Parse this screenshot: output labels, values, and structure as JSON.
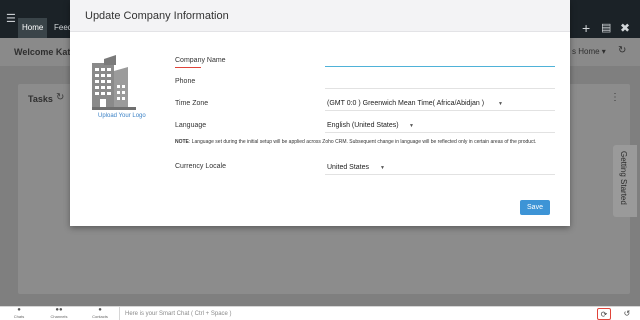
{
  "topbar": {
    "tabs": [
      {
        "label": "Home"
      },
      {
        "label": "Feeds"
      }
    ]
  },
  "subbar": {
    "welcome": "Welcome Kath",
    "home_tab": "s Home"
  },
  "tasks": {
    "title": "Tasks"
  },
  "getting_started": {
    "label": "Getting Started"
  },
  "modal": {
    "title": "Update Company Information",
    "upload_logo": "Upload Your Logo",
    "fields": {
      "company_name": {
        "label": "Company Name",
        "value": ""
      },
      "phone": {
        "label": "Phone",
        "value": ""
      },
      "time_zone": {
        "label": "Time Zone",
        "value": "(GMT 0:0 ) Greenwich Mean Time( Africa/Abidjan )"
      },
      "language": {
        "label": "Language",
        "value": "English (United States)"
      },
      "currency_locale": {
        "label": "Currency Locale",
        "value": "United States"
      }
    },
    "note_label": "NOTE",
    "note_text": ": Language set during the initial setup will be applied across Zoho CRM. Subsequent change in language will be reflected only in certain areas of the product.",
    "save_label": "Save"
  },
  "bottombar": {
    "items": [
      {
        "label": "Chats",
        "icon": "chat-icon"
      },
      {
        "label": "Channels",
        "icon": "channels-icon"
      },
      {
        "label": "Contacts",
        "icon": "contacts-icon"
      }
    ],
    "smart_chat_placeholder": "Here is your Smart Chat ( Ctrl + Space )"
  },
  "colors": {
    "accent": "#3d94d6",
    "required": "#e0443a",
    "focus": "#4fb2d8",
    "topbar": "#1b2227"
  }
}
